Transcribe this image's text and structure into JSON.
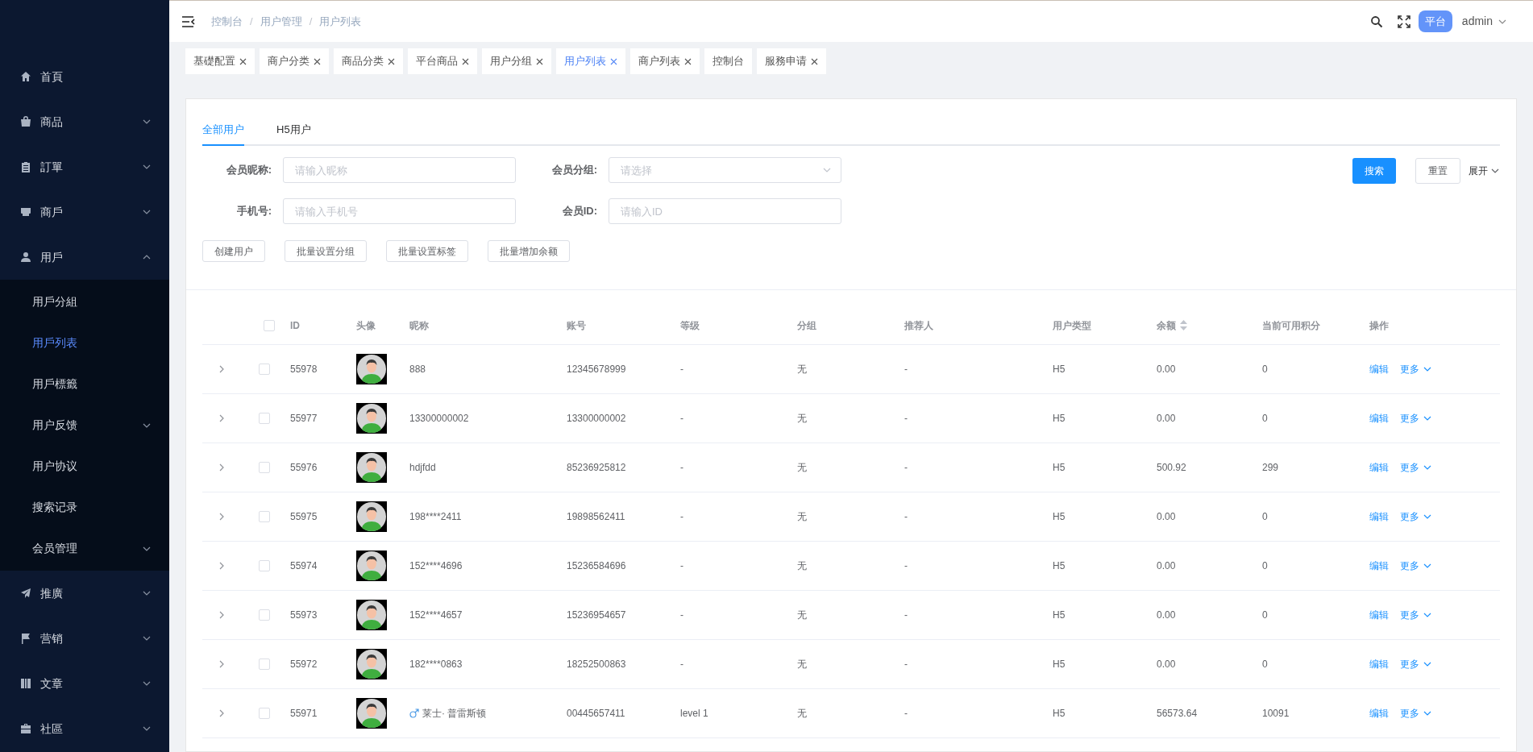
{
  "sidebar": {
    "items": [
      {
        "label": "首頁",
        "expandable": false
      },
      {
        "label": "商品",
        "expandable": true,
        "expanded": false
      },
      {
        "label": "訂單",
        "expandable": true,
        "expanded": false
      },
      {
        "label": "商戶",
        "expandable": true,
        "expanded": false
      },
      {
        "label": "用戶",
        "expandable": true,
        "expanded": true,
        "children": [
          {
            "label": "用戶分組",
            "selected": false,
            "expandable": false
          },
          {
            "label": "用戶列表",
            "selected": true,
            "expandable": false
          },
          {
            "label": "用戶標籤",
            "selected": false,
            "expandable": false
          },
          {
            "label": "用户反馈",
            "selected": false,
            "expandable": true
          },
          {
            "label": "用户协议",
            "selected": false,
            "expandable": false
          },
          {
            "label": "搜索记录",
            "selected": false,
            "expandable": false
          },
          {
            "label": "会员管理",
            "selected": false,
            "expandable": true
          }
        ]
      },
      {
        "label": "推廣",
        "expandable": true,
        "expanded": false
      },
      {
        "label": "营销",
        "expandable": true,
        "expanded": false
      },
      {
        "label": "文章",
        "expandable": true,
        "expanded": false
      },
      {
        "label": "社區",
        "expandable": true,
        "expanded": false
      }
    ]
  },
  "header": {
    "breadcrumb": [
      "控制台",
      "用户管理",
      "用户列表"
    ],
    "separator": "/",
    "role_badge": "平台",
    "user": "admin"
  },
  "tags": [
    {
      "label": "基礎配置",
      "selected": false,
      "closable": true
    },
    {
      "label": "商户分类",
      "selected": false,
      "closable": true
    },
    {
      "label": "商品分类",
      "selected": false,
      "closable": true
    },
    {
      "label": "平台商品",
      "selected": false,
      "closable": true
    },
    {
      "label": "用户分组",
      "selected": false,
      "closable": true
    },
    {
      "label": "用户列表",
      "selected": true,
      "closable": true
    },
    {
      "label": "商户列表",
      "selected": false,
      "closable": true
    },
    {
      "label": "控制台",
      "selected": false,
      "closable": false
    },
    {
      "label": "服務申请",
      "selected": false,
      "closable": true
    }
  ],
  "tabs": [
    {
      "label": "全部用户",
      "selected": true
    },
    {
      "label": "H5用户",
      "selected": false
    }
  ],
  "filters": [
    {
      "label": "会员昵称:",
      "placeholder": "请输入昵称",
      "kind": "input"
    },
    {
      "label": "会员分组:",
      "placeholder": "请选择",
      "kind": "select"
    },
    {
      "label": "手机号:",
      "placeholder": "请输入手机号",
      "kind": "input"
    },
    {
      "label": "会员ID:",
      "placeholder": "请输入ID",
      "kind": "input"
    }
  ],
  "search_button": "搜索",
  "reset_button": "重置",
  "expand_toggle": "展开",
  "actions": [
    "创建用户",
    "批量设置分组",
    "批量设置标签",
    "批量增加余额"
  ],
  "table": {
    "select_all_checked": false,
    "columns": [
      "ID",
      "头像",
      "昵称",
      "账号",
      "等级",
      "分组",
      "推荐人",
      "用户类型",
      "余额",
      "当前可用积分",
      "操作"
    ],
    "rows": [
      {
        "id": "55978",
        "nickname": "888",
        "kind": "plain",
        "account": "12345678999",
        "level": "-",
        "group": "无",
        "referrer": "-",
        "type": "H5",
        "balance": "0.00",
        "points": "0",
        "edit": "编辑",
        "more": "更多",
        "checked": false
      },
      {
        "id": "55977",
        "nickname": "13300000002",
        "kind": "plain",
        "account": "13300000002",
        "level": "-",
        "group": "无",
        "referrer": "-",
        "type": "H5",
        "balance": "0.00",
        "points": "0",
        "edit": "编辑",
        "more": "更多",
        "checked": false
      },
      {
        "id": "55976",
        "nickname": "hdjfdd",
        "kind": "plain",
        "account": "85236925812",
        "level": "-",
        "group": "无",
        "referrer": "-",
        "type": "H5",
        "balance": "500.92",
        "points": "299",
        "edit": "编辑",
        "more": "更多",
        "checked": false
      },
      {
        "id": "55975",
        "nickname": "198****2411",
        "kind": "plain",
        "account": "19898562411",
        "level": "-",
        "group": "无",
        "referrer": "-",
        "type": "H5",
        "balance": "0.00",
        "points": "0",
        "edit": "编辑",
        "more": "更多",
        "checked": false
      },
      {
        "id": "55974",
        "nickname": "152****4696",
        "kind": "plain",
        "account": "15236584696",
        "level": "-",
        "group": "无",
        "referrer": "-",
        "type": "H5",
        "balance": "0.00",
        "points": "0",
        "edit": "编辑",
        "more": "更多",
        "checked": false
      },
      {
        "id": "55973",
        "nickname": "152****4657",
        "kind": "plain",
        "account": "15236954657",
        "level": "-",
        "group": "无",
        "referrer": "-",
        "type": "H5",
        "balance": "0.00",
        "points": "0",
        "edit": "编辑",
        "more": "更多",
        "checked": false
      },
      {
        "id": "55972",
        "nickname": "182****0863",
        "kind": "plain",
        "account": "18252500863",
        "level": "-",
        "group": "无",
        "referrer": "-",
        "type": "H5",
        "balance": "0.00",
        "points": "0",
        "edit": "编辑",
        "more": "更多",
        "checked": false
      },
      {
        "id": "55971",
        "nickname": "莱士· 普雷斯顿",
        "kind": "male",
        "account": "00445657411",
        "level": "level 1",
        "group": "无",
        "referrer": "-",
        "type": "H5",
        "balance": "56573.64",
        "points": "10091",
        "edit": "编辑",
        "more": "更多",
        "checked": false
      }
    ]
  }
}
